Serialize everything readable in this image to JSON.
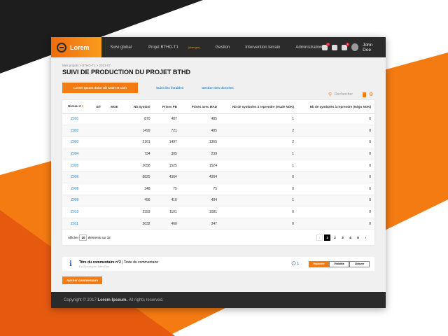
{
  "header": {
    "logo": "Lorem",
    "nav": [
      "Suivi global",
      "Projet BTHD-T1",
      "Gestion",
      "Intervention terrain",
      "Administration"
    ],
    "nav_change": "(changer)",
    "badges": [
      "2",
      "1"
    ],
    "user": "John Doe"
  },
  "breadcrumb": "Mes projets  >  BTHD-T1  >  2013-07",
  "title": "SUIVI DE PRODUCTION DU PROJET BTHD",
  "tabs": [
    "Lorem Ipsum dolor Sit Amet et com",
    "Suivi des livrables",
    "Gestion des données"
  ],
  "search": {
    "placeholder": "Rechercher"
  },
  "table": {
    "columns": [
      "Niveau 2",
      "S/T",
      "MOE",
      "Nb Symbol",
      "Prises PB",
      "Prises avec MAD",
      "Nb de symboles à reprendre (etude NOK)",
      "Nb de symboles à reprendre (Négo NOK)"
    ],
    "rows": [
      [
        "Z001",
        "",
        "",
        "870",
        "487",
        "485",
        "1",
        "0"
      ],
      [
        "Z002",
        "",
        "",
        "1499",
        "721",
        "485",
        "2",
        "0"
      ],
      [
        "Z003",
        "",
        "",
        "2161",
        "1497",
        "1365",
        "2",
        "0"
      ],
      [
        "Z004",
        "",
        "",
        "734",
        "305",
        "239",
        "1",
        "0"
      ],
      [
        "Z005",
        "",
        "",
        "2058",
        "1525",
        "1524",
        "1",
        "0"
      ],
      [
        "Z006",
        "",
        "",
        "8825",
        "4364",
        "4364",
        "0",
        "0"
      ],
      [
        "Z008",
        "",
        "",
        "348",
        "75",
        "75",
        "0",
        "0"
      ],
      [
        "Z009",
        "",
        "",
        "456",
        "410",
        "404",
        "1",
        "0"
      ],
      [
        "Z010",
        "",
        "",
        "2393",
        "1101",
        "1081",
        "0",
        "0"
      ],
      [
        "Z011",
        "",
        "",
        "2032",
        "460",
        "347",
        "0",
        "0"
      ]
    ]
  },
  "pager": {
    "show_label": "Afficher",
    "page_size": "10",
    "total_label": "élements sur 32",
    "pages": [
      "1",
      "2",
      "3",
      "4",
      "5"
    ],
    "prev": "‹",
    "next": "›"
  },
  "comment": {
    "title": "Titre du commentaire n°2",
    "sep": "|",
    "text": "Texte du commentaire",
    "meta": "Il y 2 jours par John Doe",
    "count": "1",
    "buttons": [
      "Répondre",
      "Visibilité",
      "Clôturer"
    ]
  },
  "add_comment": "Ajouter commentaire",
  "footer": {
    "copy": "Copyright © 2017",
    "brand": "Lorem Ipseum.",
    "rights": "All rights reserved."
  }
}
